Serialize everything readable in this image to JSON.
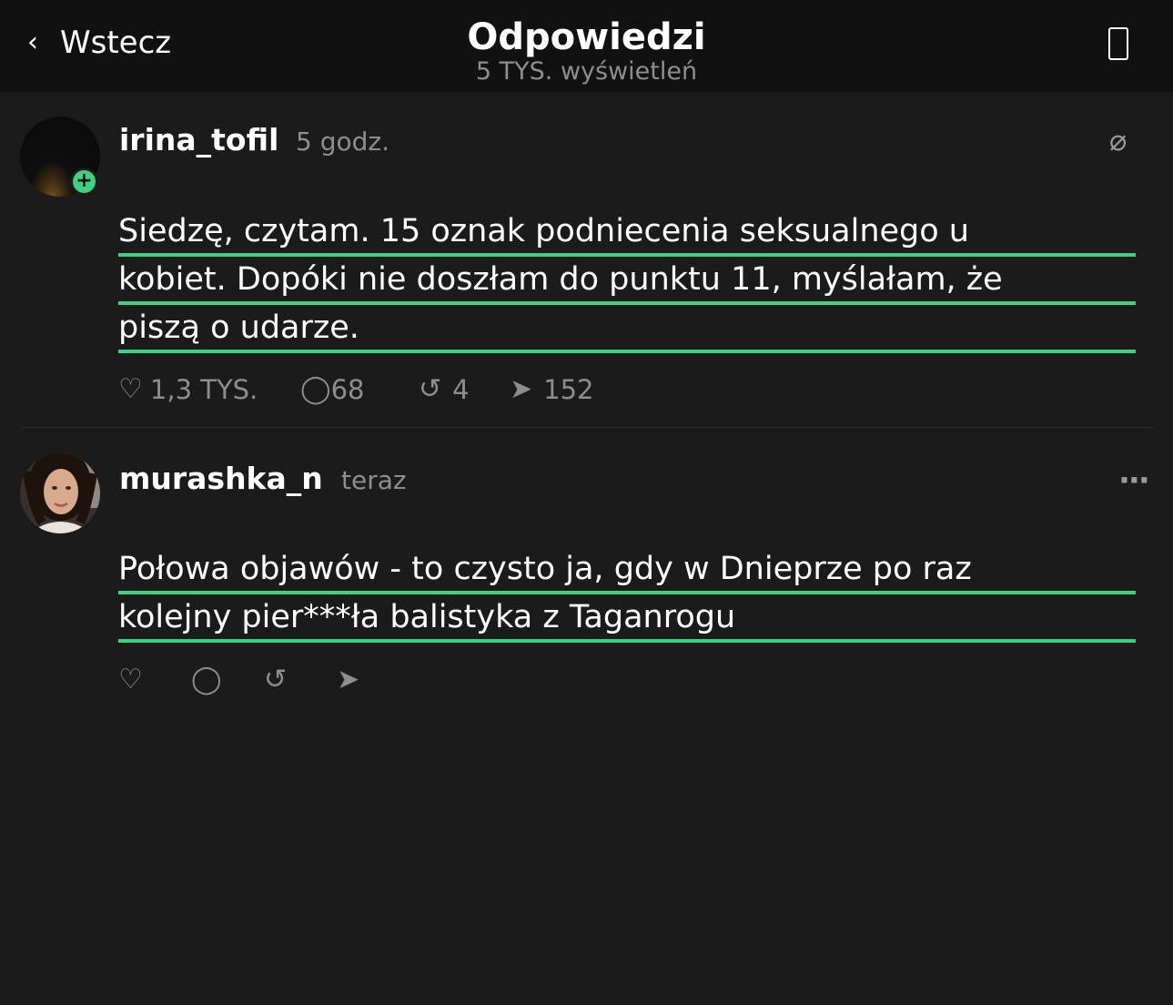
{
  "header": {
    "back_label": "Wstecz",
    "title": "Odpowiedzi",
    "subtitle": "5 TYS. wyświetleń",
    "back_icon": "chevron-left-icon",
    "right_icon": "device-frame-icon"
  },
  "posts": [
    {
      "username": "irina_tofil",
      "time": "5 godz.",
      "corner_icon": "⌀",
      "text_lines": [
        "Siedzę, czytam. 15 oznak podniecenia seksualnego u",
        "kobiet. Dopóki nie doszłam do punktu 11, myślałam, że",
        "piszą o udarze."
      ],
      "likes": "1,3 TYS.",
      "comments": "68",
      "reposts": "4",
      "shares": "152",
      "has_follow_badge": true
    },
    {
      "username": "murashka_n",
      "time": "teraz",
      "corner_icon": "···",
      "text_lines": [
        "Połowa objawów - to czysto ja, gdy w Dnieprze po raz",
        "kolejny pier***ła balistyka z Taganrogu"
      ],
      "likes": "",
      "comments": "",
      "reposts": "",
      "shares": ""
    }
  ],
  "icons": {
    "like": "♡",
    "comment": "◯",
    "repost": "↺",
    "share": "➤",
    "follow": "+"
  },
  "colors": {
    "background": "#1b1b1b",
    "header_background": "#111111",
    "accent_underline": "#3fd182",
    "muted_text": "#8e8e8e"
  }
}
